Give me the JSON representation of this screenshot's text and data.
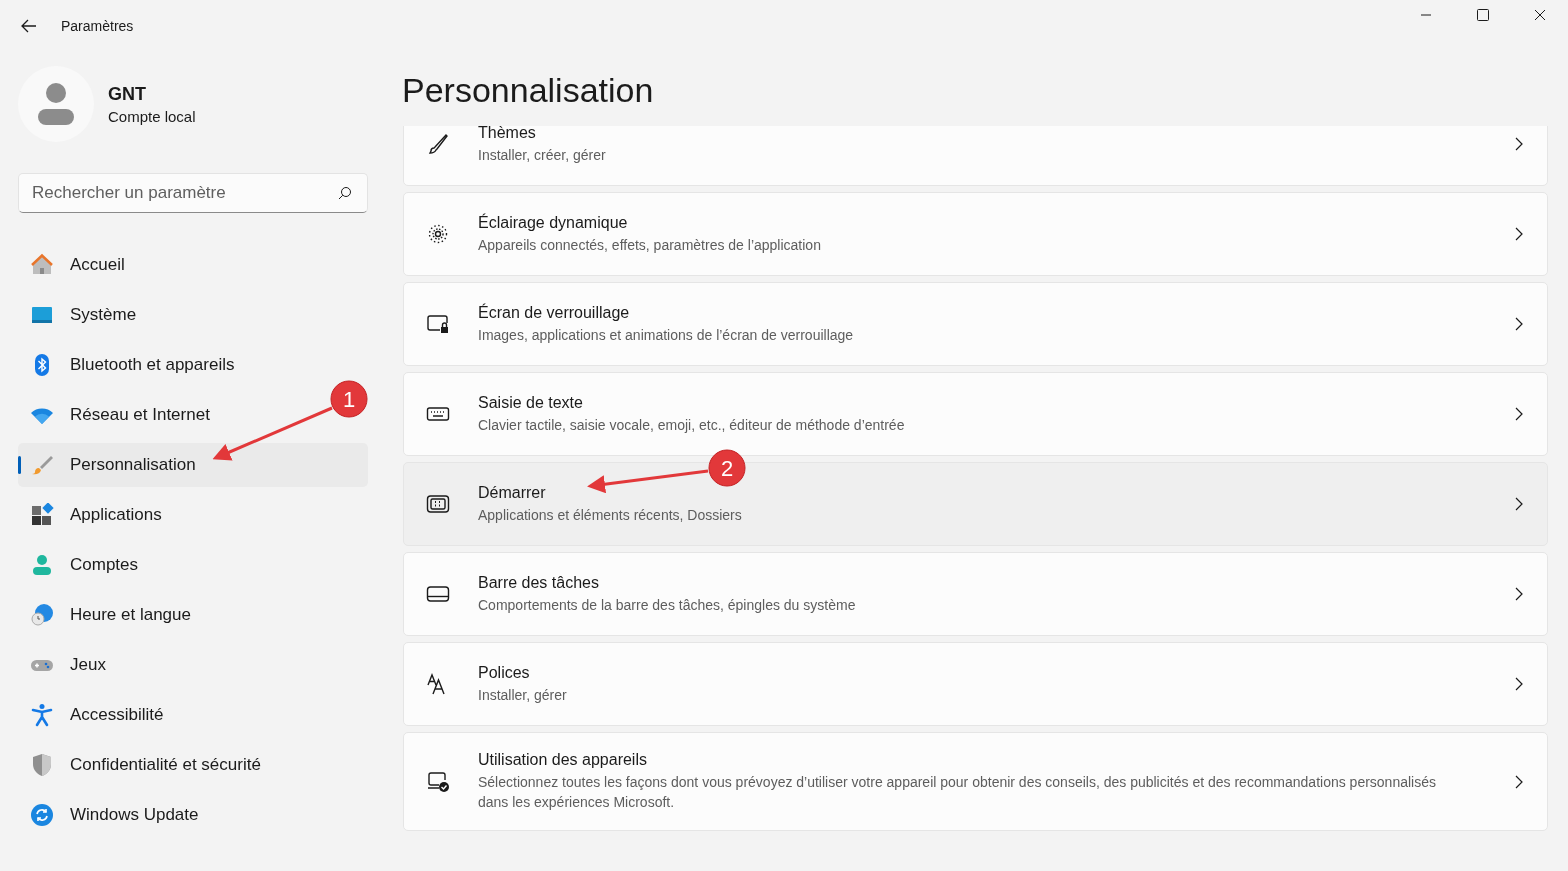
{
  "window": {
    "title": "Paramètres"
  },
  "profile": {
    "name": "GNT",
    "account": "Compte local"
  },
  "search": {
    "placeholder": "Rechercher un paramètre"
  },
  "sidebar": {
    "items": [
      {
        "label": "Accueil",
        "selected": false
      },
      {
        "label": "Système",
        "selected": false
      },
      {
        "label": "Bluetooth et appareils",
        "selected": false
      },
      {
        "label": "Réseau et Internet",
        "selected": false
      },
      {
        "label": "Personnalisation",
        "selected": true
      },
      {
        "label": "Applications",
        "selected": false
      },
      {
        "label": "Comptes",
        "selected": false
      },
      {
        "label": "Heure et langue",
        "selected": false
      },
      {
        "label": "Jeux",
        "selected": false
      },
      {
        "label": "Accessibilité",
        "selected": false
      },
      {
        "label": "Confidentialité et sécurité",
        "selected": false
      },
      {
        "label": "Windows Update",
        "selected": false
      }
    ]
  },
  "page": {
    "title": "Personnalisation"
  },
  "cards": [
    {
      "title": "Thèmes",
      "subtitle": "Installer, créer, gérer",
      "hovered": false
    },
    {
      "title": "Éclairage dynamique",
      "subtitle": "Appareils connectés, effets, paramètres de l’application",
      "hovered": false
    },
    {
      "title": "Écran de verrouillage",
      "subtitle": "Images, applications et animations de l’écran de verrouillage",
      "hovered": false
    },
    {
      "title": "Saisie de texte",
      "subtitle": "Clavier tactile, saisie vocale, emoji, etc., éditeur de méthode d’entrée",
      "hovered": false
    },
    {
      "title": "Démarrer",
      "subtitle": "Applications et éléments récents, Dossiers",
      "hovered": true
    },
    {
      "title": "Barre des tâches",
      "subtitle": "Comportements de la barre des tâches, épingles du système",
      "hovered": false
    },
    {
      "title": "Polices",
      "subtitle": "Installer, gérer",
      "hovered": false
    },
    {
      "title": "Utilisation des appareils",
      "subtitle": "Sélectionnez toutes les façons dont vous prévoyez d’utiliser votre appareil pour obtenir des conseils, des publicités et des recommandations personnalisés dans les expériences Microsoft.",
      "hovered": false
    }
  ],
  "annotations": [
    {
      "label": "1"
    },
    {
      "label": "2"
    }
  ]
}
